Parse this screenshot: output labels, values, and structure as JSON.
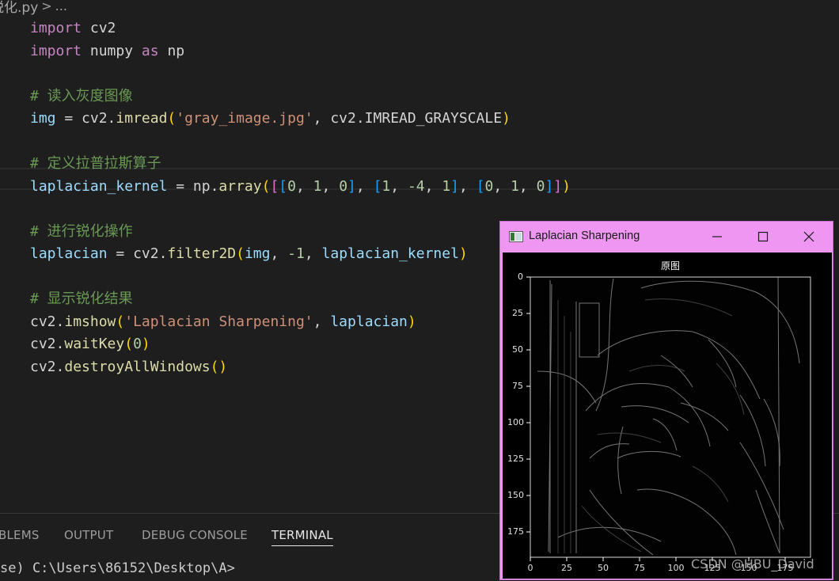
{
  "breadcrumb": {
    "file": "锐化.py",
    "separator": ">",
    "more": "..."
  },
  "code": {
    "l1_kw": "import",
    "l1_mod": "cv2",
    "l2_kw": "import",
    "l2_mod": "numpy",
    "l2_as": "as",
    "l2_alias": "np",
    "l4_comment": "# 读入灰度图像",
    "l5_var": "img",
    "l5_eq": " = ",
    "l5_mod": "cv2.",
    "l5_fn": "imread",
    "l5_open": "(",
    "l5_str": "'gray_image.jpg'",
    "l5_mid": ", cv2.IMREAD_GRAYSCALE",
    "l5_close": ")",
    "l7_comment": "# 定义拉普拉斯算子",
    "l8_var": "laplacian_kernel",
    "l8_eq": " = ",
    "l8_mod": "np.",
    "l8_fn": "array",
    "l8_p": "(",
    "l8_o1": "[",
    "l8_o2": "[",
    "l8_a1": "0",
    "l8_a2": "1",
    "l8_a3": "0",
    "l8_b1": "1",
    "l8_b2": "-4",
    "l8_b3": "1",
    "l8_c1": "0",
    "l8_c2": "1",
    "l8_c3": "0",
    "l8_c": "]",
    "l8_cc": "]",
    "l8_pc": ")",
    "l8_comma": ", ",
    "l10_comment": "# 进行锐化操作",
    "l11_var": "laplacian",
    "l11_eq": " = ",
    "l11_mod": "cv2.",
    "l11_fn": "filter2D",
    "l11_open": "(",
    "l11_arg1": "img",
    "l11_sep": ", ",
    "l11_num": "-1",
    "l11_arg3": "laplacian_kernel",
    "l11_close": ")",
    "l13_comment": "# 显示锐化结果",
    "l14_mod": "cv2.",
    "l14_fn": "imshow",
    "l14_open": "(",
    "l14_str": "'Laplacian Sharpening'",
    "l14_sep": ", ",
    "l14_arg": "laplacian",
    "l14_close": ")",
    "l15_mod": "cv2.",
    "l15_fn": "waitKey",
    "l15_open": "(",
    "l15_num": "0",
    "l15_close": ")",
    "l16_mod": "cv2.",
    "l16_fn": "destroyAllWindows",
    "l16_parens": "()"
  },
  "panel": {
    "tabs": [
      "BLEMS",
      "OUTPUT",
      "DEBUG CONSOLE",
      "TERMINAL"
    ],
    "active_tab": "TERMINAL",
    "prompt": "se) C:\\Users\\86152\\Desktop\\A>"
  },
  "cv_window": {
    "title": "Laplacian Sharpening",
    "plot_title": "原图",
    "y_ticks": [
      "0",
      "25",
      "50",
      "75",
      "100",
      "125",
      "150",
      "175"
    ],
    "x_ticks": [
      "0",
      "25",
      "50",
      "75",
      "100",
      "125",
      "150",
      "175"
    ],
    "watermark": "CSDN @HBU_David"
  },
  "colors": {
    "titlebar": "#ee96f2",
    "editor_bg": "#1e1e1e"
  },
  "icons": [
    "app-icon",
    "minimize-icon",
    "maximize-icon",
    "close-icon"
  ]
}
